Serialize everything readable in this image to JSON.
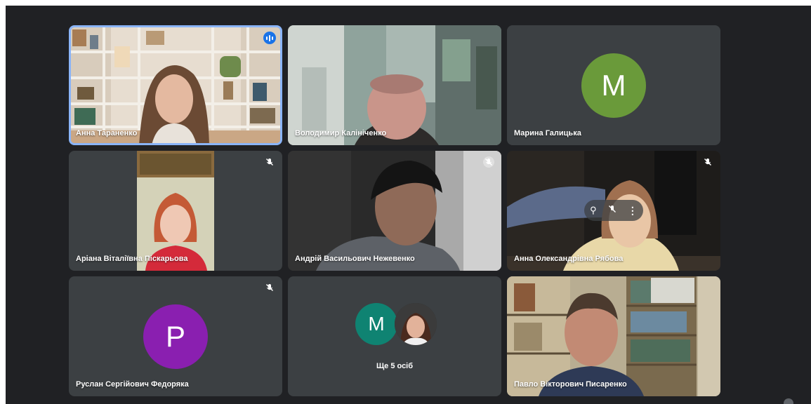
{
  "participants": [
    {
      "name": "Анна Тараненко",
      "state": "speaking",
      "media": "video"
    },
    {
      "name": "Володимир Калініченко",
      "state": "unmuted",
      "media": "video"
    },
    {
      "name": "Марина Галицька",
      "state": "unmuted",
      "media": "avatar",
      "initial": "M",
      "color": "#6a9a3a"
    },
    {
      "name": "Аріана Віталіївна Піскарьова",
      "state": "muted",
      "media": "video"
    },
    {
      "name": "Андрій Васильович Нежевенко",
      "state": "muted",
      "media": "video"
    },
    {
      "name": "Анна Олександрівна Рябова",
      "state": "muted",
      "media": "video"
    },
    {
      "name": "Руслан Сергійович Федоряка",
      "state": "muted",
      "media": "avatar",
      "initial": "P",
      "color": "#8a1fb0"
    },
    {
      "name": "Павло Вікторович Писаренко",
      "state": "unmuted",
      "media": "video"
    }
  ],
  "others_tile": {
    "label": "Ще 5 осіб",
    "avatar_initial": "M",
    "avatar_color": "#0f8372"
  },
  "colors": {
    "stage": "#202124",
    "tile": "#3c4043",
    "speaking_border": "#8ab4f8",
    "speaking_indicator": "#1a73e8"
  },
  "icons": [
    "audio-level-icon",
    "mic-off-icon",
    "pin-icon",
    "more-vert-icon"
  ]
}
